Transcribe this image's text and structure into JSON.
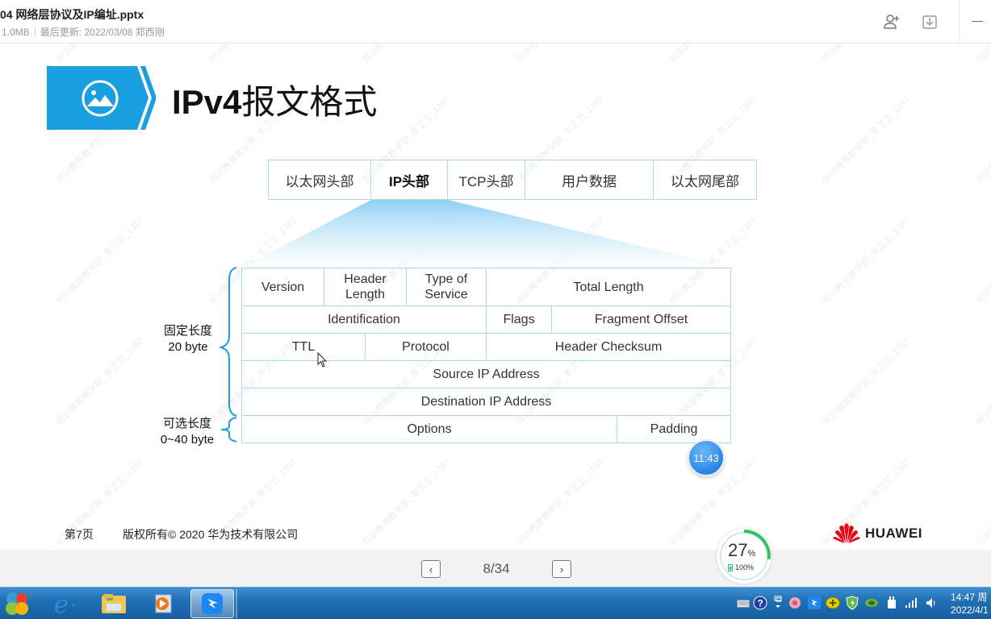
{
  "window": {
    "file_name": "04 网络层协议及IP编址.pptx",
    "file_size": "1.0MB",
    "last_updated_label": "最后更新:",
    "last_updated_date": "2022/03/08",
    "author": "郑西刚",
    "icons": [
      "add-user-icon",
      "download-icon",
      "minimize-icon"
    ]
  },
  "slide": {
    "title_en": "IPv4",
    "title_zh": "报文格式",
    "title_icon": "image-icon",
    "frame": {
      "cells": [
        {
          "label": "以太网头部",
          "bold": false
        },
        {
          "label": "IP头部",
          "bold": true
        },
        {
          "label": "TCP头部",
          "bold": false
        },
        {
          "label": "用户数据",
          "bold": false
        },
        {
          "label": "以太网尾部",
          "bold": false
        }
      ]
    },
    "header_fields": {
      "row1": [
        "Version",
        "Header Length",
        "Type of Service",
        "Total Length"
      ],
      "row2": [
        "Identification",
        "Flags",
        "Fragment Offset"
      ],
      "row3": [
        "TTL",
        "Protocol",
        "Header Checksum"
      ],
      "row4": [
        "Source IP Address"
      ],
      "row5": [
        "Destination IP Address"
      ],
      "row6": [
        "Options",
        "Padding"
      ]
    },
    "fixed_label_line1": "固定长度",
    "fixed_label_line2": "20 byte",
    "optional_label_line1": "可选长度",
    "optional_label_line2": "0~40 byte",
    "footer_page": "第7页",
    "footer_copyright": "版权所有© 2020 华为技术有限公司",
    "brand": "HUAWEI",
    "watermark_text": "阿训教育教学部_李卫卫_1397",
    "brand_color": "#1a9fe0"
  },
  "timer_badge": "11:43",
  "navigation": {
    "prev_label": "‹",
    "next_label": "›",
    "page_indicator": "8/34"
  },
  "progress_widget": {
    "percent": "27",
    "percent_unit": "%",
    "percent_value": 27,
    "battery": "100%"
  },
  "taskbar": {
    "apps": [
      "start-orb",
      "internet-explorer",
      "file-explorer",
      "media-player",
      "dingtalk"
    ],
    "tray": [
      "keyboard",
      "help",
      "network-switch",
      "flower-app",
      "dingtalk-tray",
      "plus-app",
      "security-shield",
      "nvidia",
      "power",
      "signal",
      "volume"
    ],
    "time": "14:47 周",
    "date": "2022/4/1"
  }
}
